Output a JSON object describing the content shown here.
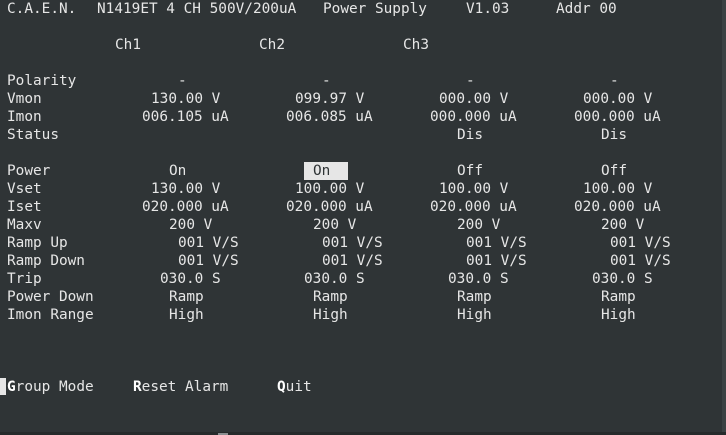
{
  "header": {
    "vendor": "C.A.E.N.",
    "model": "N1419ET 4 CH 500V/200uA",
    "title": "Power Supply",
    "version": "V1.03",
    "address": "Addr 00"
  },
  "columns": [
    "Ch1",
    "Ch2",
    "Ch3"
  ],
  "rows": {
    "polarity": {
      "label": "Polarity",
      "values": [
        "-",
        "-",
        "-",
        "-"
      ]
    },
    "vmon": {
      "label": "Vmon",
      "values": [
        "130.00 V",
        "099.97 V",
        "000.00 V",
        "000.00 V"
      ]
    },
    "imon": {
      "label": "Imon",
      "values": [
        "006.105 uA",
        "006.085 uA",
        "000.000 uA",
        "000.000 uA"
      ]
    },
    "status": {
      "label": "Status",
      "values": [
        "",
        "",
        "Dis",
        "Dis"
      ]
    },
    "power": {
      "label": "Power",
      "values": [
        "On",
        "On",
        "Off",
        "Off"
      ]
    },
    "vset": {
      "label": "Vset",
      "values": [
        "130.00 V",
        "100.00 V",
        "100.00 V",
        "100.00 V"
      ]
    },
    "iset": {
      "label": "Iset",
      "values": [
        "020.000 uA",
        "020.000 uA",
        "020.000 uA",
        "020.000 uA"
      ]
    },
    "maxv": {
      "label": "Maxv",
      "values": [
        "200 V",
        "200 V",
        "200 V",
        "200 V"
      ]
    },
    "ramp_up": {
      "label": "Ramp Up",
      "values": [
        "001 V/S",
        "001 V/S",
        "001 V/S",
        "001 V/S"
      ]
    },
    "ramp_down": {
      "label": "Ramp Down",
      "values": [
        "001 V/S",
        "001 V/S",
        "001 V/S",
        "001 V/S"
      ]
    },
    "trip": {
      "label": "Trip",
      "values": [
        "030.0 S",
        "030.0 S",
        "030.0 S",
        "030.0 S"
      ]
    },
    "power_down": {
      "label": "Power Down",
      "values": [
        "Ramp",
        "Ramp",
        "Ramp",
        "Ramp"
      ]
    },
    "imon_range": {
      "label": "Imon Range",
      "values": [
        "High",
        "High",
        "High",
        "High"
      ]
    }
  },
  "menu": {
    "group_mode": {
      "hotkey": "G",
      "rest": "roup Mode"
    },
    "reset_alarm": {
      "hotkey": "R",
      "rest": "eset Alarm"
    },
    "quit": {
      "hotkey": "Q",
      "rest": "uit"
    }
  },
  "colors": {
    "background": "#2f3436",
    "text": "#e6e6e6",
    "highlight_bg": "#e6e6e6",
    "highlight_fg": "#2f3436"
  }
}
